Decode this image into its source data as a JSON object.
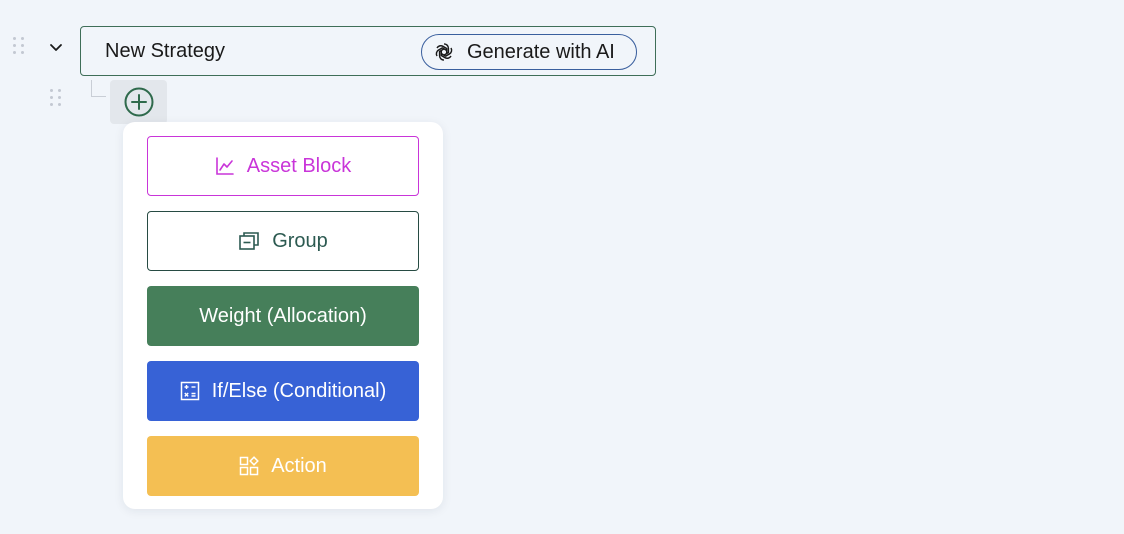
{
  "strategy": {
    "name": "New Strategy",
    "generate_label": "Generate with AI"
  },
  "add_menu": {
    "asset_block": {
      "label": "Asset Block",
      "icon": "line-chart-icon",
      "color": "#c935d9"
    },
    "group": {
      "label": "Group",
      "icon": "group-icon",
      "color": "#2c5a51"
    },
    "weight": {
      "label": "Weight (Allocation)",
      "color": "#467f5a"
    },
    "if_else": {
      "label": "If/Else (Conditional)",
      "icon": "calculator-icon",
      "color": "#3762d6"
    },
    "action": {
      "label": "Action",
      "icon": "shapes-icon",
      "color": "#f4bf53"
    }
  }
}
